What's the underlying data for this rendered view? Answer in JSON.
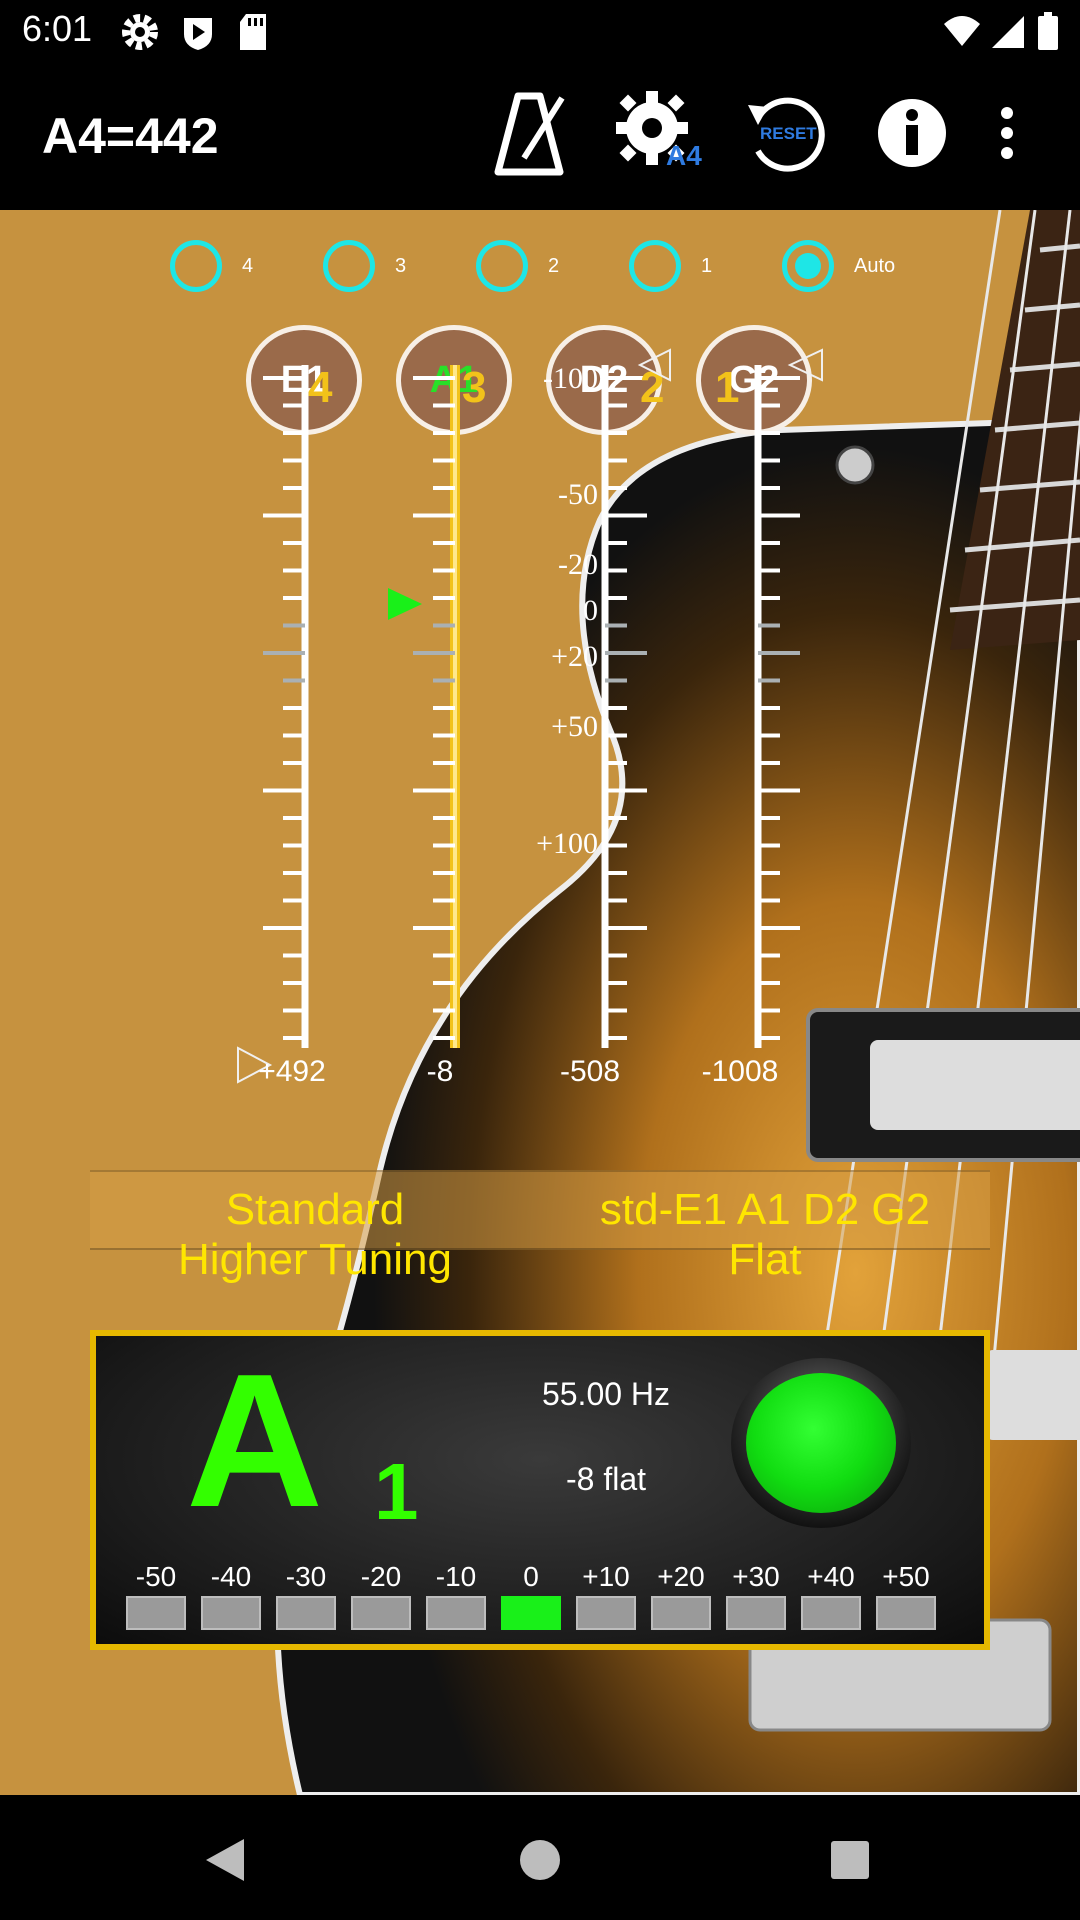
{
  "status_bar": {
    "time": "6:01",
    "icons": [
      "gear-icon",
      "play-shield-icon",
      "sd-card-icon",
      "wifi-icon",
      "cell-signal-icon",
      "battery-icon"
    ]
  },
  "app_bar": {
    "title": "A4=442",
    "actions": [
      "metronome-icon",
      "settings-a4-icon",
      "reset-icon",
      "info-icon",
      "overflow-menu-icon"
    ],
    "settings_badge": "A4",
    "reset_badge": "RESET"
  },
  "string_select": {
    "options": [
      {
        "label": "4",
        "selected": false
      },
      {
        "label": "3",
        "selected": false
      },
      {
        "label": "2",
        "selected": false
      },
      {
        "label": "1",
        "selected": false
      },
      {
        "label": "Auto",
        "selected": true
      }
    ]
  },
  "strings": [
    {
      "note": "E1",
      "active": false,
      "number": "4",
      "readout": "+492"
    },
    {
      "note": "A1",
      "active": true,
      "number": "3",
      "readout": "-8"
    },
    {
      "note": "D2",
      "active": false,
      "number": "2",
      "readout": "-508"
    },
    {
      "note": "G2",
      "active": false,
      "number": "1",
      "readout": "-1008"
    }
  ],
  "scale_labels": [
    "-100",
    "-50",
    "-20",
    "0",
    "+20",
    "+50",
    "+100"
  ],
  "info": {
    "tuning_name": "Standard",
    "tuning_notes": "std-E1 A1 D2 G2",
    "mode": "Higher Tuning",
    "accidental": "Flat"
  },
  "tuner": {
    "note": "A",
    "octave": "1",
    "frequency": "55.00 Hz",
    "cents": "-8 flat",
    "scale": [
      "-50",
      "-40",
      "-30",
      "-20",
      "-10",
      "0",
      "+10",
      "+20",
      "+30",
      "+40",
      "+50"
    ],
    "active_index": 5,
    "colors": {
      "in_tune": "#19f019",
      "frame": "#e6b800",
      "note": "#33ff00"
    }
  },
  "colors": {
    "background": "#c6923f",
    "highlight_text": "#ffe600",
    "radio": "#1ee6e6"
  }
}
